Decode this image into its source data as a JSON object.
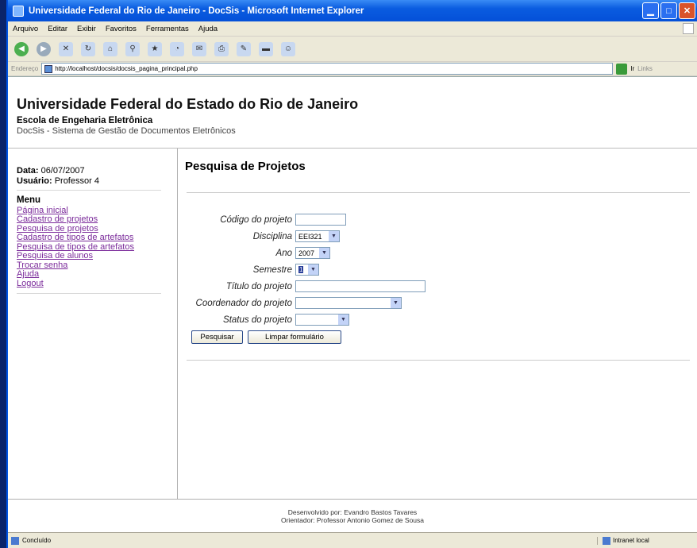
{
  "window": {
    "title": "Universidade Federal do Rio de Janeiro - DocSis - Microsoft Internet Explorer"
  },
  "menubar": {
    "items": [
      "Arquivo",
      "Editar",
      "Exibir",
      "Favoritos",
      "Ferramentas",
      "Ajuda"
    ]
  },
  "address": {
    "label": "Endereço",
    "url": "http://localhost/docsis/docsis_pagina_principal.php",
    "go": "Ir",
    "links": "Links"
  },
  "header": {
    "title": "Universidade Federal do Estado do Rio de Janeiro",
    "school": "Escola de Engeharia Eletrônica",
    "system": "DocSis - Sistema de Gestão de Documentos Eletrônicos"
  },
  "sidebar": {
    "date_label": "Data:",
    "date_value": "06/07/2007",
    "user_label": "Usuário:",
    "user_value": "Professor 4",
    "menu_title": "Menu",
    "items": [
      "Página inicial",
      "Cadastro de projetos",
      "Pesquisa de projetos",
      "Cadastro de tipos de artefatos",
      "Pesquisa de tipos de artefatos",
      "Pesquisa de alunos",
      "Trocar senha",
      "Ajuda",
      "Logout"
    ]
  },
  "form": {
    "title": "Pesquisa de Projetos",
    "codigo_label": "Código do projeto",
    "codigo_value": "",
    "disciplina_label": "Disciplina",
    "disciplina_value": "EEI321",
    "ano_label": "Ano",
    "ano_value": "2007",
    "semestre_label": "Semestre",
    "semestre_value": "1",
    "titulo_label": "Título do projeto",
    "titulo_value": "",
    "coordenador_label": "Coordenador do projeto",
    "coordenador_value": "",
    "status_label": "Status do projeto",
    "status_value": "",
    "search_button": "Pesquisar",
    "clear_button": "Limpar formulário"
  },
  "footer": {
    "line1": "Desenvolvido por: Evandro Bastos Tavares",
    "line2": "Orientador: Professor Antonio Gomez de Sousa"
  },
  "statusbar": {
    "text": "Concluído",
    "zone": "Intranet local"
  }
}
